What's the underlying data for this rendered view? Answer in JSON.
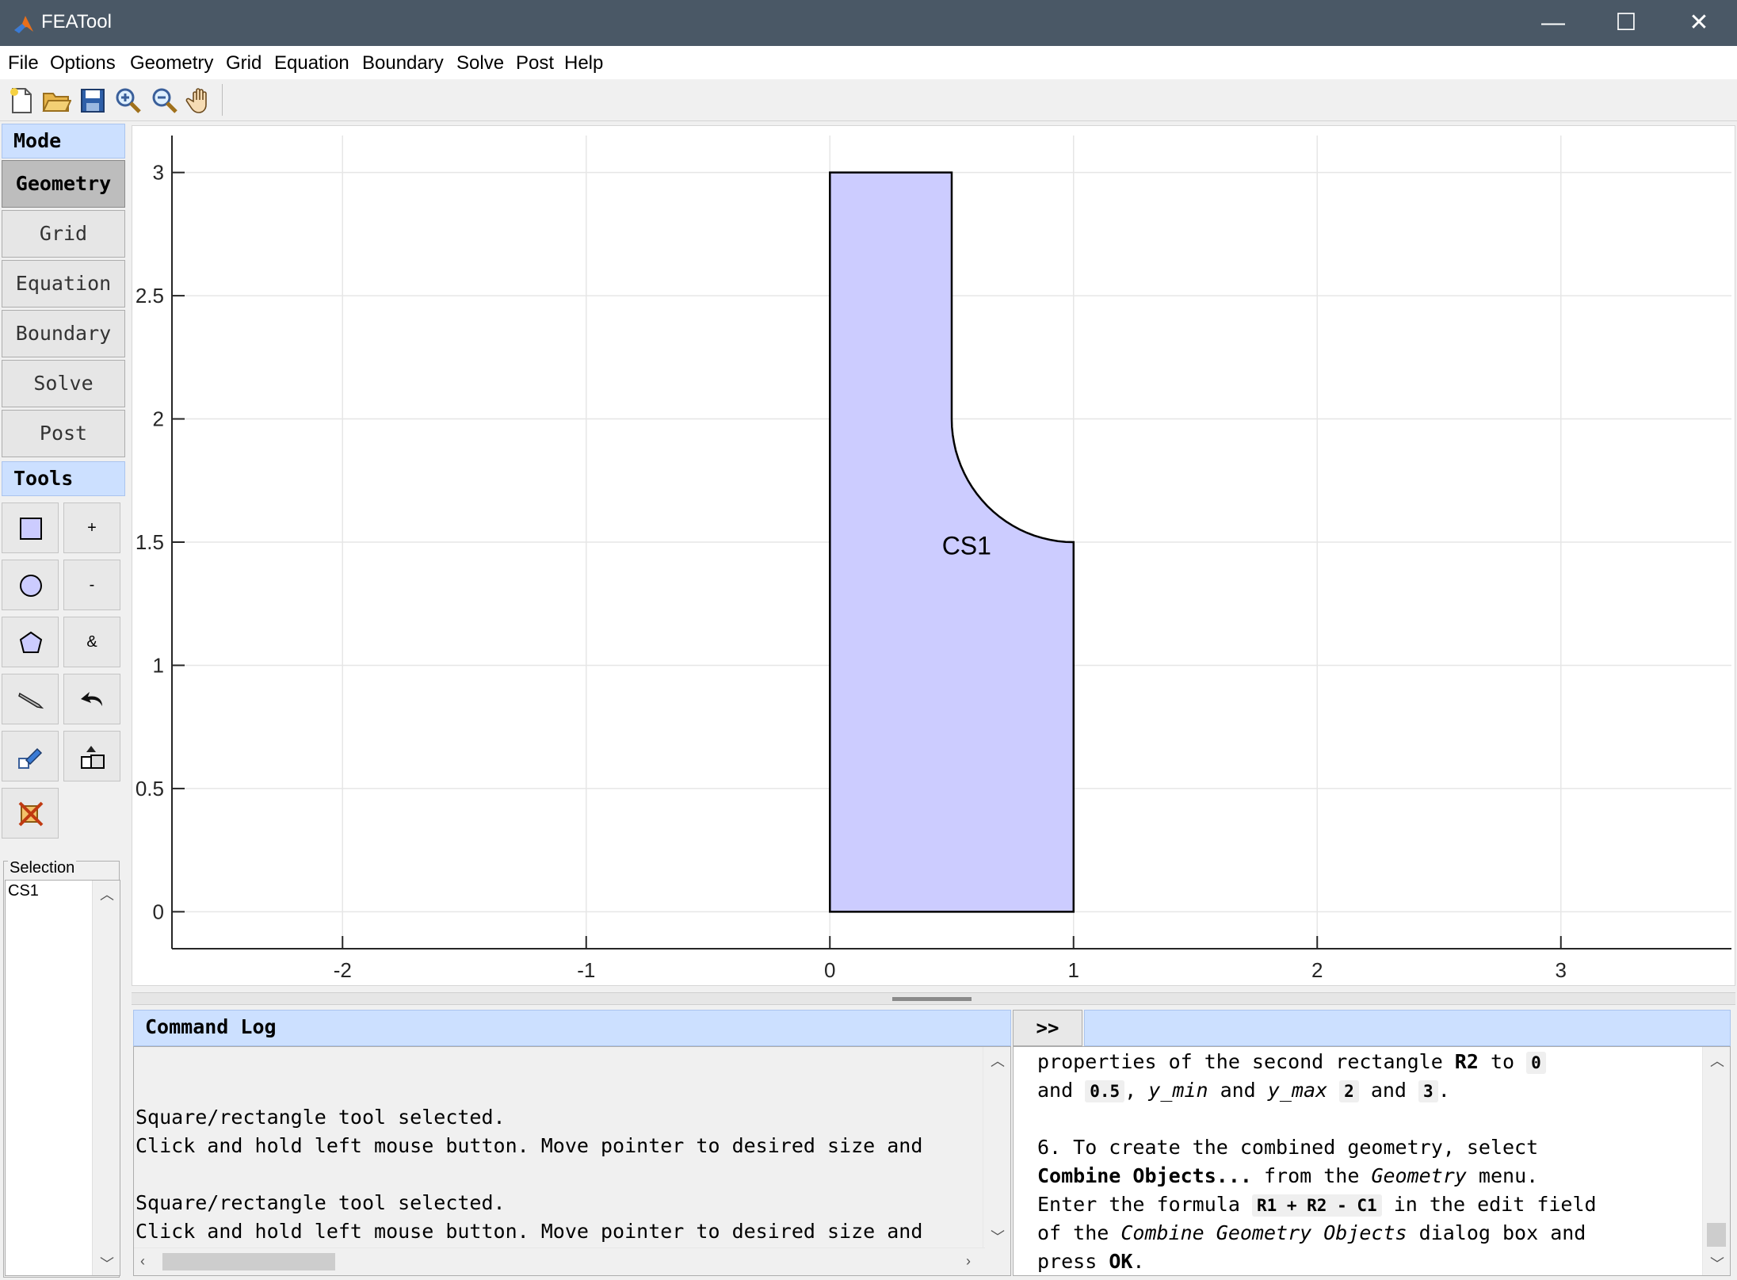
{
  "window": {
    "title": "FEATool",
    "minimize": "—",
    "maximize": "☐",
    "close": "✕"
  },
  "menu": [
    "File",
    "Options",
    "Geometry",
    "Grid",
    "Equation",
    "Boundary",
    "Solve",
    "Post",
    "Help"
  ],
  "toolbar": {
    "icons": [
      "new-file-icon",
      "open-folder-icon",
      "save-icon",
      "zoom-in-icon",
      "zoom-out-icon",
      "pan-hand-icon"
    ]
  },
  "mode": {
    "header": "Mode",
    "buttons": [
      "Geometry",
      "Grid",
      "Equation",
      "Boundary",
      "Solve",
      "Post"
    ],
    "active": "Geometry"
  },
  "tools": {
    "header": "Tools",
    "plus": "+",
    "minus": "-",
    "intersect": "&"
  },
  "selection": {
    "label": "Selection",
    "items": [
      "CS1"
    ]
  },
  "plot": {
    "x_ticks": [
      "-2",
      "-1",
      "0",
      "1",
      "2",
      "3"
    ],
    "y_ticks": [
      "0",
      "0.5",
      "1",
      "1.5",
      "2",
      "2.5",
      "3"
    ],
    "xlim": [
      -2.7,
      3.7
    ],
    "ylim": [
      -0.15,
      3.15
    ],
    "object_label": "CS1",
    "fill_color": "#ccccff",
    "edge_color": "#000000",
    "grid": true
  },
  "command_log": {
    "header": "Command Log",
    "expand_button": ">>",
    "lines": [
      "",
      "",
      "Square/rectangle tool selected.",
      "Click and hold left mouse button. Move pointer to desired size and",
      "",
      "Square/rectangle tool selected.",
      "Click and hold left mouse button. Move pointer to desired size and"
    ]
  },
  "help_text": {
    "line1_a": "properties of the second rectangle ",
    "line1_b": "R2",
    "line1_c": " to ",
    "line1_d": "0",
    "line2_a": "and ",
    "line2_b": "0.5",
    "line2_c": ", ",
    "line2_d": "y_min",
    "line2_e": " and ",
    "line2_f": "y_max",
    "line2_g": "2",
    "line2_h": " and ",
    "line2_i": "3",
    "line2_j": ".",
    "line3": "6. To create the combined geometry, select",
    "line4_a": "Combine Objects...",
    "line4_b": " from the ",
    "line4_c": "Geometry",
    "line4_d": " menu.",
    "line5_a": "Enter the formula ",
    "line5_b": "R1 + R2 - C1",
    "line5_c": " in the edit field",
    "line6_a": "of the ",
    "line6_b": "Combine Geometry Objects",
    "line6_c": " dialog box and",
    "line7_a": "press ",
    "line7_b": "OK",
    "line7_c": "."
  }
}
